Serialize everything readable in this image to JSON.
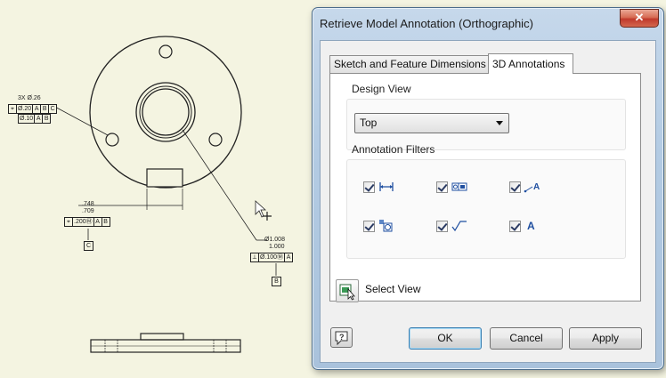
{
  "drawing": {
    "hole_callout": "3X Ø.26",
    "fcf1": [
      "⌖",
      "Ø.20",
      "A",
      "B",
      "C"
    ],
    "fcf2": [
      "Ø.10",
      "A",
      "B"
    ],
    "dim_upper": ".748",
    "dim_lower": ".709",
    "fcf3": [
      "⌖",
      ".200Ⓜ",
      "A",
      "B"
    ],
    "datum_c": "C",
    "dia_upper": "Ø1.008",
    "dia_lower": "1.000",
    "fcf4": [
      "⟂",
      "Ø.100Ⓜ",
      "A"
    ],
    "datum_b": "B"
  },
  "dialog": {
    "title": "Retrieve Model Annotation (Orthographic)",
    "close_symbol": "✕",
    "tabs": [
      "Sketch and Feature Dimensions",
      "3D Annotations"
    ],
    "active_tab": 1,
    "design_view": {
      "label": "Design View",
      "selected": "Top"
    },
    "filters": {
      "label": "Annotation Filters",
      "items": [
        {
          "icon": "linear-dimension-icon",
          "checked": true
        },
        {
          "icon": "feature-control-frame-icon",
          "checked": true
        },
        {
          "icon": "leader-note-icon",
          "checked": true
        },
        {
          "icon": "datum-target-icon",
          "checked": true
        },
        {
          "icon": "surface-texture-icon",
          "checked": true
        },
        {
          "icon": "text-annotation-icon",
          "checked": true,
          "glyph": "A"
        }
      ]
    },
    "select_view_label": "Select View",
    "buttons": {
      "ok": "OK",
      "cancel": "Cancel",
      "apply": "Apply"
    }
  }
}
